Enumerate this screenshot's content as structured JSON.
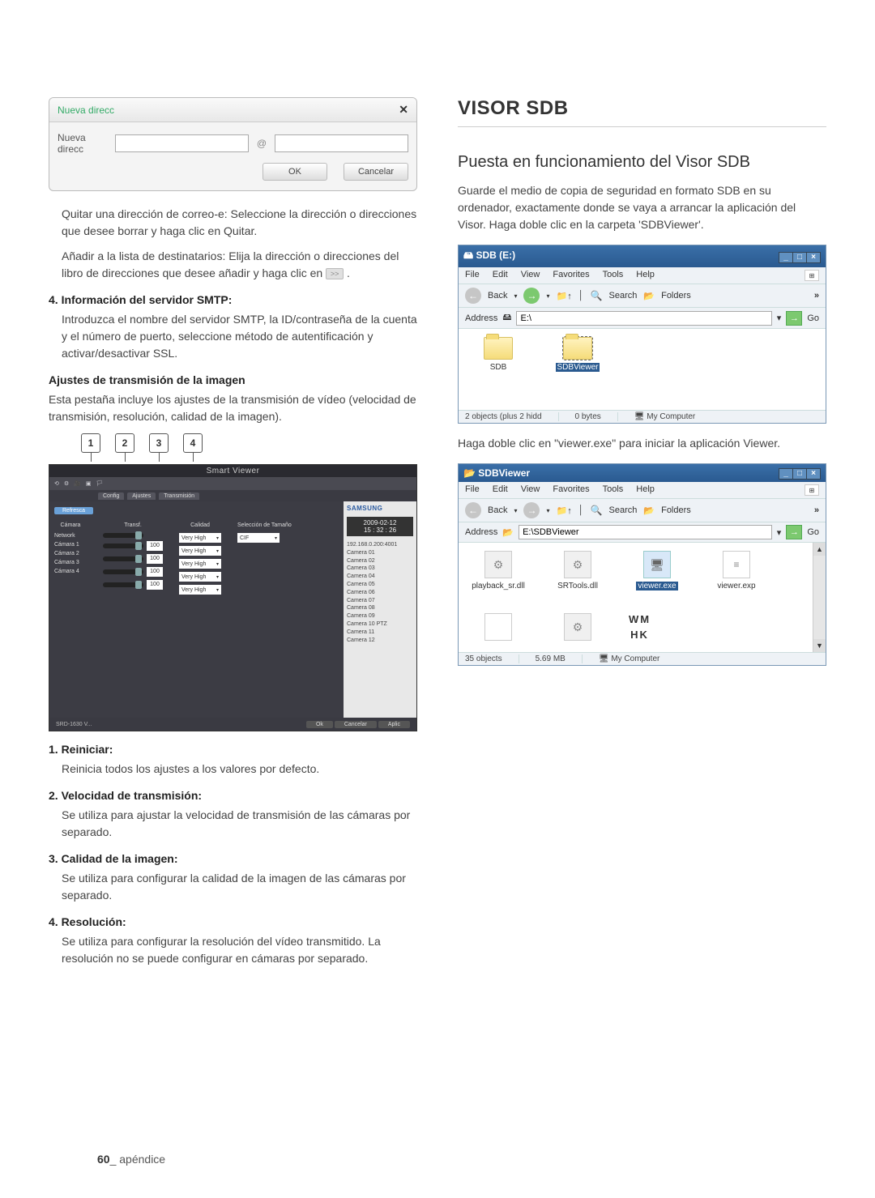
{
  "dialog": {
    "title": "Nueva direcc",
    "field_label": "Nueva direcc",
    "at": "@",
    "ok": "OK",
    "cancel": "Cancelar"
  },
  "left": {
    "para1": "Quitar una dirección de correo-e: Seleccione la dirección o direcciones que desee borrar y haga clic en Quitar.",
    "para2a": "Añadir a la lista de destinatarios: Elija la dirección o direcciones del libro de direcciones que desee añadir y haga clic en ",
    "para2b": ".",
    "h4": "4. Información del servidor SMTP:",
    "para3": "Introduzca el nombre del servidor SMTP, la ID/contraseña de la cuenta y el número de puerto, seleccione método de autentificación y activar/desactivar SSL.",
    "h_trans": "Ajustes de transmisión de la imagen",
    "para4": "Esta pestaña incluye los ajustes de la transmisión de vídeo (velocidad de transmisión, resolución, calidad de la imagen).",
    "callouts": [
      "1",
      "2",
      "3",
      "4"
    ],
    "sv": {
      "title": "Smart Viewer",
      "brand": "SAMSUNG",
      "date": "2009-02-12",
      "time": "15 : 32 : 26",
      "refresh": "Refresca",
      "root": "192.168.0.200:4001",
      "cams_tree": [
        "Camera 01",
        "Camera 02",
        "Camera 03",
        "Camera 04",
        "Camera 05",
        "Camera 06",
        "Camera 07",
        "Camera 08",
        "Camera 09",
        "Camera 10 PTZ",
        "Camera 11",
        "Camera 12"
      ],
      "col_camera": "Cámara",
      "col_trans": "Transf.",
      "col_quality": "Calidad",
      "col_res": "Selección de Tamaño",
      "network": "Network",
      "cams": [
        "Cámara 1",
        "Cámara 2",
        "Cámara 3",
        "Cámara 4"
      ],
      "num": "100",
      "qual": "Very High",
      "footer_device": "SRD-1630 V...",
      "footer_ok": "Ok",
      "footer_cancel": "Cancelar",
      "footer_apply": "Aplic"
    },
    "items": {
      "i1h": "1. Reiniciar:",
      "i1b": "Reinicia todos los ajustes a los valores por defecto.",
      "i2h": "2. Velocidad de transmisión:",
      "i2b": "Se utiliza para ajustar la velocidad de transmisión de las cámaras por separado.",
      "i3h": "3. Calidad de la imagen:",
      "i3b": "Se utiliza para configurar la calidad de la imagen de las cámaras por separado.",
      "i4h": "4. Resolución:",
      "i4b": "Se utiliza para configurar la resolución del vídeo transmitido. La resolución no se puede configurar en cámaras por separado."
    }
  },
  "right": {
    "h1": "VISOR SDB",
    "h2": "Puesta en funcionamiento del Visor SDB",
    "para1": "Guarde el medio de copia de seguridad en formato SDB en su ordenador, exactamente donde se vaya a arrancar la aplicación del Visor.  Haga doble clic en la carpeta 'SDBViewer'.",
    "exp1": {
      "title": "SDB (E:)",
      "menu": [
        "File",
        "Edit",
        "View",
        "Favorites",
        "Tools",
        "Help"
      ],
      "back": "Back",
      "search": "Search",
      "folders": "Folders",
      "addr_label": "Address",
      "addr": "E:\\",
      "go": "Go",
      "folders_list": [
        "SDB",
        "SDBViewer"
      ],
      "status_left": "2 objects (plus 2 hidd",
      "status_mid": "0 bytes",
      "status_right": "My Computer"
    },
    "para2": "Haga doble clic en \"viewer.exe\" para iniciar la aplicación Viewer.",
    "exp2": {
      "title": "SDBViewer",
      "menu": [
        "File",
        "Edit",
        "View",
        "Favorites",
        "Tools",
        "Help"
      ],
      "back": "Back",
      "search": "Search",
      "folders": "Folders",
      "addr_label": "Address",
      "addr": "E:\\SDBViewer",
      "go": "Go",
      "files": [
        "playback_sr.dll",
        "SRTools.dll",
        "viewer.exe",
        "viewer.exp"
      ],
      "wm": "WM",
      "hk": "HK",
      "status_left": "35 objects",
      "status_mid": "5.69 MB",
      "status_right": "My Computer"
    }
  },
  "footer": {
    "num": "60",
    "sep": "_ ",
    "label": "apéndice"
  }
}
